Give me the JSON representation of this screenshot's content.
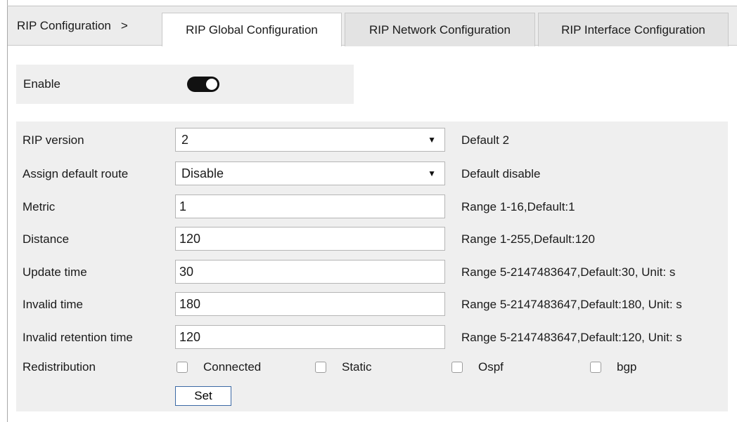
{
  "tabs": {
    "breadcrumb": "RIP Configuration",
    "separator": ">",
    "global": "RIP Global Configuration",
    "network": "RIP Network Configuration",
    "interface": "RIP Interface Configuration"
  },
  "enable": {
    "label": "Enable",
    "state": "on"
  },
  "rows": [
    {
      "label": "RIP version",
      "value": "2",
      "hint": "Default 2",
      "kind": "select"
    },
    {
      "label": "Assign default route",
      "value": "Disable",
      "hint": "Default disable",
      "kind": "select"
    },
    {
      "label": "Metric",
      "value": "1",
      "hint": "Range 1-16,Default:1",
      "kind": "input"
    },
    {
      "label": "Distance",
      "value": "120",
      "hint": "Range 1-255,Default:120",
      "kind": "input"
    },
    {
      "label": "Update time",
      "value": "30",
      "hint": "Range 5-2147483647,Default:30, Unit: s",
      "kind": "input"
    },
    {
      "label": "Invalid time",
      "value": "180",
      "hint": "Range 5-2147483647,Default:180, Unit: s",
      "kind": "input"
    },
    {
      "label": "Invalid retention time",
      "value": "120",
      "hint": "Range 5-2147483647,Default:120, Unit: s",
      "kind": "input"
    }
  ],
  "redistribution": {
    "label": "Redistribution",
    "options": [
      {
        "label": "Connected",
        "checked": false
      },
      {
        "label": "Static",
        "checked": false
      },
      {
        "label": "Ospf",
        "checked": false
      },
      {
        "label": "bgp",
        "checked": false
      }
    ]
  },
  "set_button": "Set",
  "colors": {
    "panel_bg": "#efefef",
    "toggle_on": "#111111",
    "button_border": "#3c6aa5"
  }
}
